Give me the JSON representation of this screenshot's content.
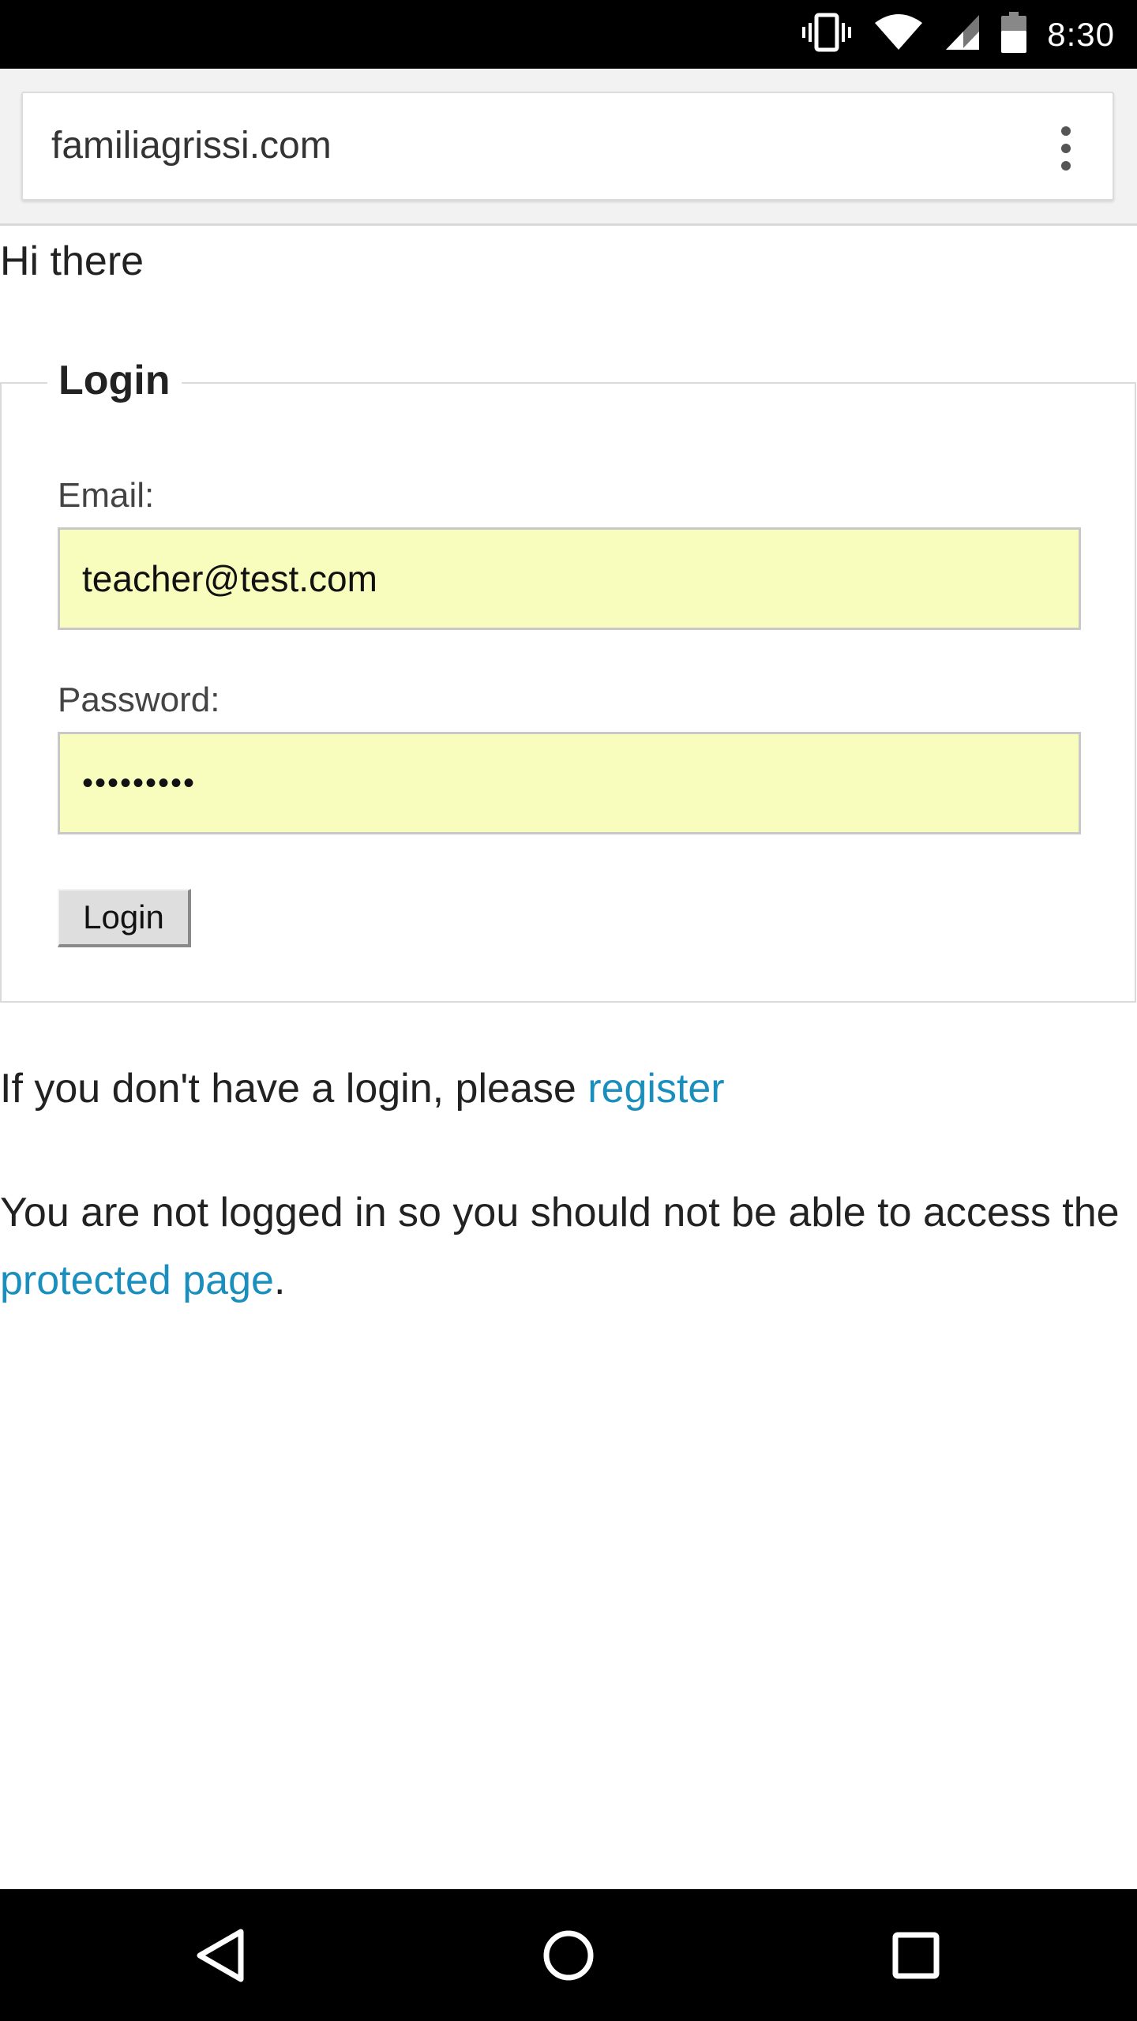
{
  "status_bar": {
    "time": "8:30",
    "icons": [
      "vibrate-icon",
      "wifi-icon",
      "cell-signal-icon",
      "battery-icon"
    ]
  },
  "browser": {
    "url": "familiagrissi.com",
    "menu_icon": "more-vert-icon"
  },
  "page": {
    "greeting": "Hi there",
    "login": {
      "legend": "Login",
      "email_label": "Email:",
      "email_value": "teacher@test.com",
      "password_label": "Password:",
      "password_value": "•••••••••",
      "button_label": "Login",
      "autofill_color": "#f8fcbc"
    },
    "register_text": "If you don't have a login, please ",
    "register_link": "register",
    "notice_text_start": "You are not logged in so you should not be able to access the ",
    "protected_link": "protected page",
    "notice_text_end": ".",
    "link_color": "#1a8fbd"
  },
  "nav_bar": {
    "buttons": [
      "back-icon",
      "home-icon",
      "recents-icon"
    ]
  }
}
